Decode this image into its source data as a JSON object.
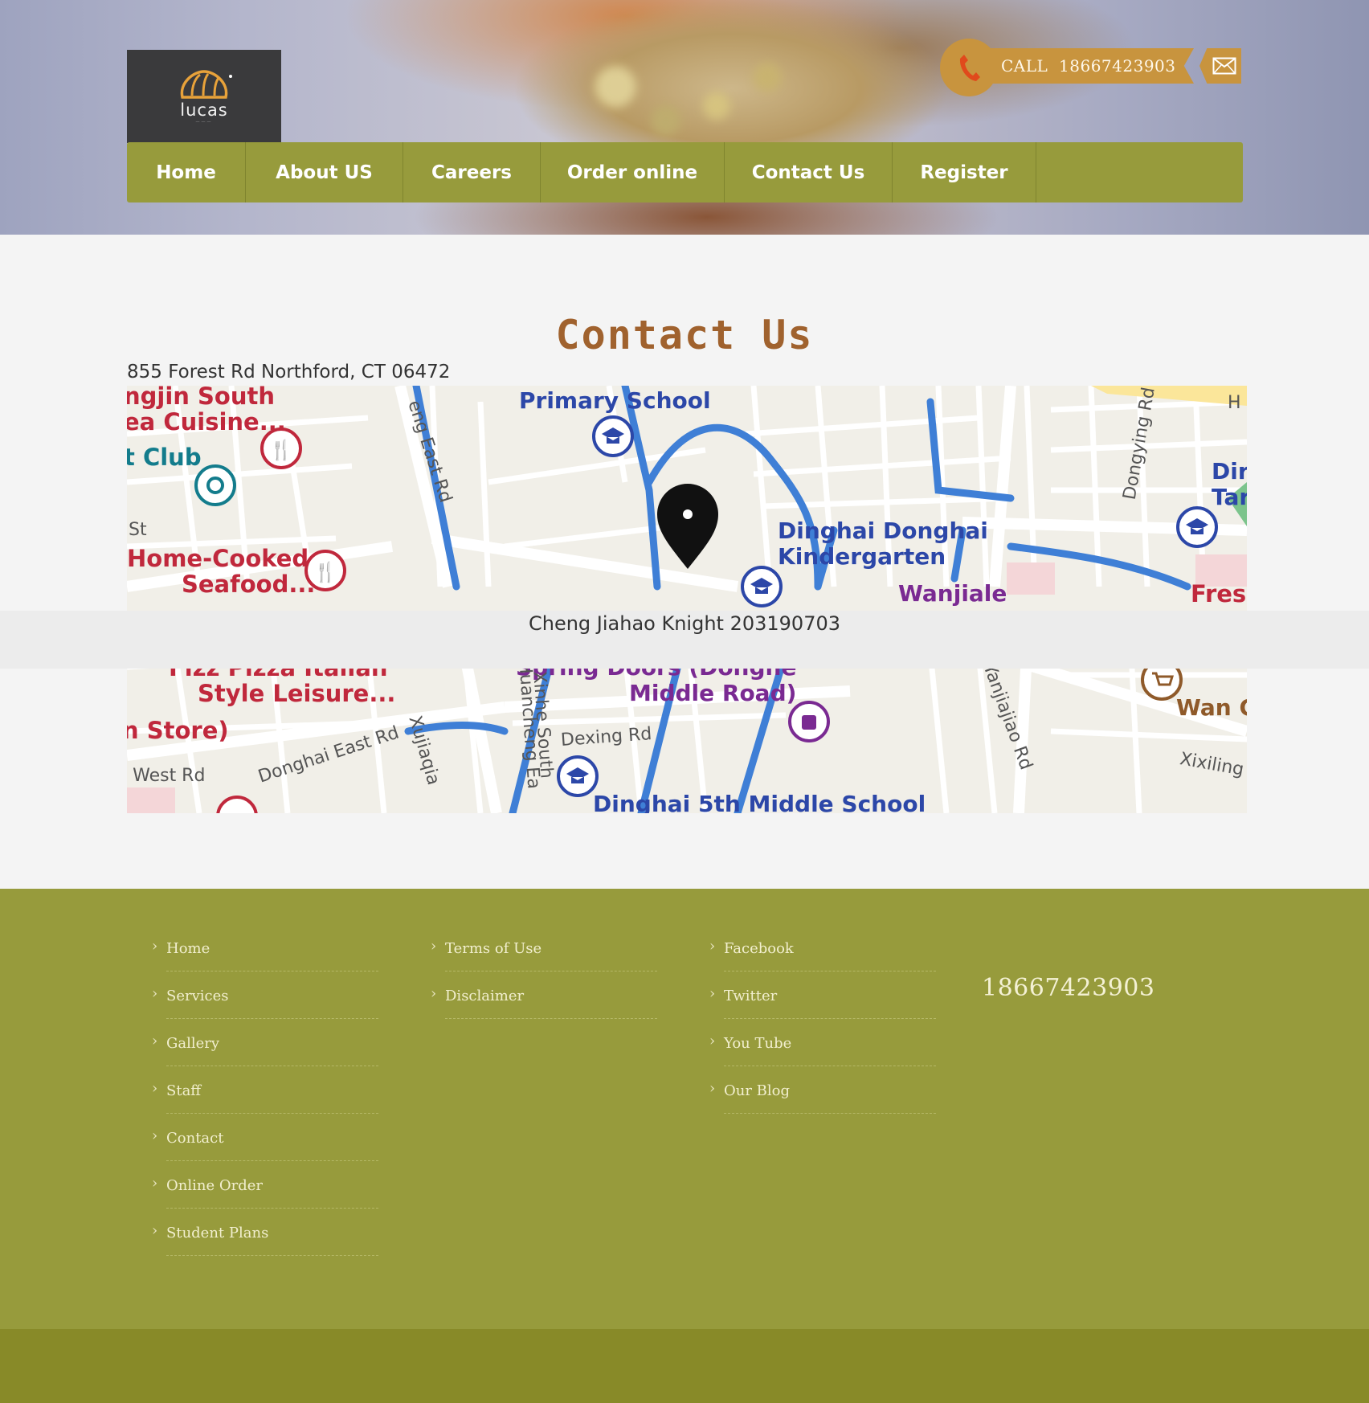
{
  "header": {
    "logo_text": "lucas",
    "call_label": "CALL",
    "phone": "18667423903",
    "icons": {
      "phone": "phone-icon",
      "mail": "envelope-icon",
      "logo": "bread-icon"
    }
  },
  "nav": {
    "items": [
      {
        "label": "Home"
      },
      {
        "label": "About US"
      },
      {
        "label": "Careers"
      },
      {
        "label": "Order online"
      },
      {
        "label": "Contact Us"
      },
      {
        "label": "Register"
      }
    ]
  },
  "main": {
    "title": "Contact Us",
    "address": "855 Forest Rd Northford, CT 06472",
    "credit": "Cheng Jiahao Knight 203190703",
    "map": {
      "labels": {
        "l1": "ngjin South",
        "l2": "ea Cuisine...",
        "l3": "t Club",
        "l4": "St",
        "l5": "Home-Cooked",
        "l6": "Seafood...",
        "l7": "Primary School",
        "l8": "Dinghai Donghai",
        "l9": "Kindergarten",
        "l10": "Wanjiale",
        "l11": "Dir",
        "l12": "Tar",
        "l13": "Fresh",
        "l14": "H",
        "l15": "eng East Rd",
        "l16": "Dongying Rd",
        "l17": "Fizz Pizza Italian",
        "l18": "Style Leisure...",
        "l19": "n Store)",
        "l20": "i West Rd",
        "l21": "Donghai East Rd",
        "l22": "Spring Doors (Donghe",
        "l23": "Middle Road)",
        "l24": "Dexing Rd",
        "l25": "Dinghai 5th Middle School",
        "l26": "Wan C",
        "l27": "Xixiling",
        "l28": "Yanjiajiao Rd",
        "l29": "Xinhe South",
        "l30": "Huancheng Ea",
        "l31": "Xujiaqia"
      }
    }
  },
  "footer": {
    "col1": [
      "Home",
      "Services",
      "Gallery",
      "Staff",
      "Contact",
      "Online Order",
      "Student Plans"
    ],
    "col2": [
      "Terms of Use",
      "Disclaimer"
    ],
    "col3": [
      "Facebook",
      "Twitter",
      "You Tube",
      "Our Blog"
    ],
    "phone": "18667423903"
  },
  "colors": {
    "nav": "#979b3c",
    "footer": "#979b3c",
    "footer_bottom": "#888a28",
    "accent": "#c8943e",
    "title": "#a0622e"
  }
}
